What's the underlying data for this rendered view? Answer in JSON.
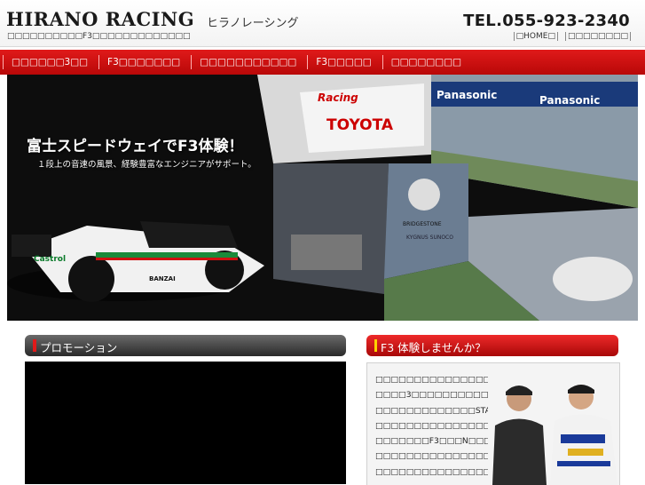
{
  "header": {
    "logo": "HIRANO RACING",
    "logo_kana": "ヒラノレーシング",
    "tagline": "□□□□□□□□□□F3□□□□□□□□□□□□□",
    "tel": "TEL.055-923-2340",
    "links": [
      {
        "label": "□HOME□"
      },
      {
        "label": "□□□□□□□□"
      }
    ]
  },
  "nav": {
    "items": [
      {
        "label": "□□□□□□3□□"
      },
      {
        "label": "F3□□□□□□□"
      },
      {
        "label": "□□□□□□□□□□□"
      },
      {
        "label": "F3□□□□□"
      },
      {
        "label": "□□□□□□□□"
      }
    ]
  },
  "hero": {
    "title": "富士スピードウェイでF3体験！",
    "subtitle": "１段上の音速の風景、経験豊富なエンジニアがサポート。",
    "scene_labels": [
      "Panasonic",
      "TOYOTA",
      "Racing",
      "Castrol",
      "BANZAI",
      "BRIDGESTONE",
      "KYGNUS SUNOCO"
    ]
  },
  "promo": {
    "heading": "プロモーション"
  },
  "f3": {
    "heading": "F3 体験しませんか？",
    "lines": [
      "□□□□□□□□□□□□□□□□□□□",
      "□□□□3□□□□□□□□□□□□□□",
      "□□□□□□□□□□□□□START□",
      "□□□□□□□□□□□□□□□□F3□",
      "□□□□□□□F3□□□N□□□□□□",
      "□□□□□□□□□□□□□□□□□□□",
      "□□□□□□□□□□□□□□□"
    ]
  },
  "colors": {
    "nav_red": "#c80f0f",
    "promo_dark": "#3a3a3a",
    "accent_yellow": "#ffd200"
  }
}
